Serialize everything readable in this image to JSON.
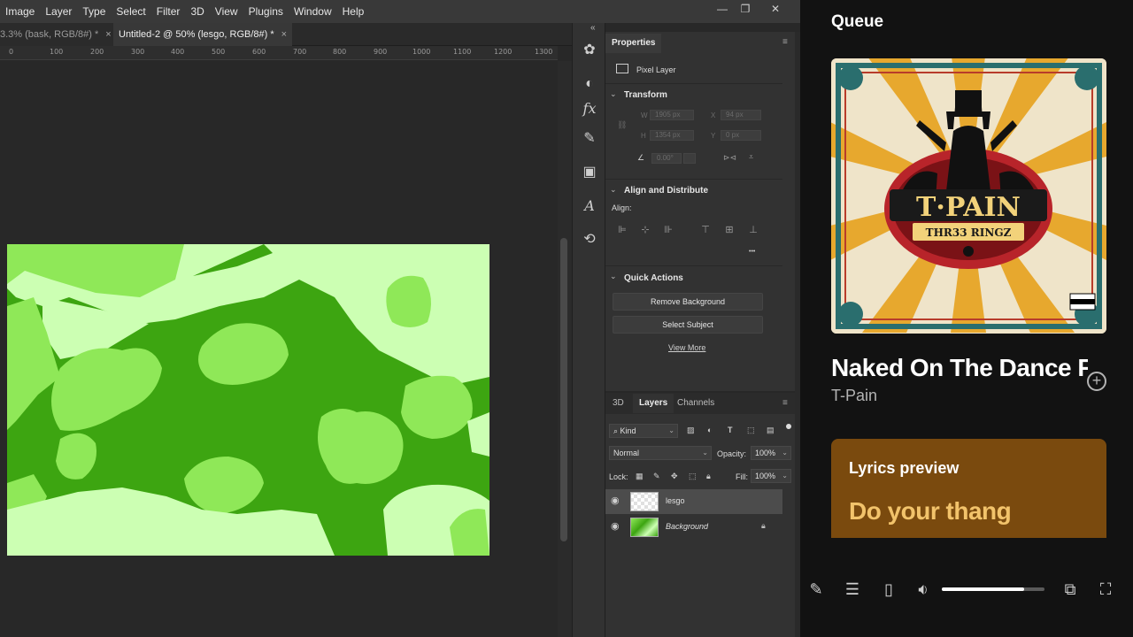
{
  "photoshop": {
    "menu": [
      "Image",
      "Layer",
      "Type",
      "Select",
      "Filter",
      "3D",
      "View",
      "Plugins",
      "Window",
      "Help"
    ],
    "window_controls": {
      "minimize": "—",
      "restore": "❐",
      "close": "✕"
    },
    "tabs": [
      {
        "label": "3.3% (bask, RGB/8#) *",
        "close": "×"
      },
      {
        "label": "Untitled-2 @ 50% (lesgo, RGB/8#) *",
        "close": "×"
      }
    ],
    "ruler": [
      "0",
      "100",
      "200",
      "300",
      "400",
      "500",
      "600",
      "700",
      "800",
      "900",
      "1000",
      "1100",
      "1200",
      "1300"
    ],
    "properties": {
      "tab": "Properties",
      "kind": "Pixel Layer",
      "transform_title": "Transform",
      "w_label": "W",
      "w_value": "1905 px",
      "x_label": "X",
      "x_value": "94 px",
      "h_label": "H",
      "h_value": "1354 px",
      "y_label": "Y",
      "y_value": "0 px",
      "angle_value": "0.00°",
      "align_title": "Align and Distribute",
      "align_label": "Align:",
      "quick_actions_title": "Quick Actions",
      "remove_bg": "Remove Background",
      "select_subject": "Select Subject",
      "view_more": "View More",
      "more_dots": "•••"
    },
    "layers_panel": {
      "tabs": [
        "3D",
        "Layers",
        "Channels"
      ],
      "kind_filter": "Kind",
      "blend_mode": "Normal",
      "opacity_label": "Opacity:",
      "opacity_value": "100%",
      "lock_label": "Lock:",
      "fill_label": "Fill:",
      "fill_value": "100%",
      "layers": [
        {
          "name": "lesgo",
          "selected": true
        },
        {
          "name": "Background",
          "selected": false,
          "locked": true
        }
      ]
    }
  },
  "spotify": {
    "queue_title": "Queue",
    "album": {
      "artist_lettering": "T·PAIN",
      "album_lettering": "THR33 RINGZ",
      "advisory": "PARENTAL ADVISORY EXPLICIT CONTENT"
    },
    "track_title": "Naked On The Dance Floor",
    "track_artist": "T-Pain",
    "lyrics_title": "Lyrics preview",
    "lyrics_line": "Do your thang",
    "volume_fraction": 0.8,
    "colors": {
      "lyrics_bg": "#7a4a0e",
      "lyrics_text": "#f2c36b"
    }
  }
}
